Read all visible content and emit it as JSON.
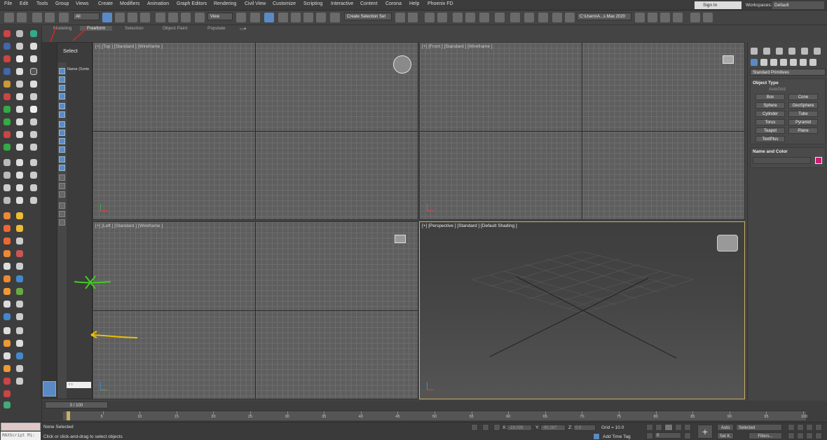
{
  "menu": {
    "items": [
      "File",
      "Edit",
      "Tools",
      "Group",
      "Views",
      "Create",
      "Modifiers",
      "Animation",
      "Graph Editors",
      "Rendering",
      "Civil View",
      "Customize",
      "Scripting",
      "Interactive",
      "Content",
      "Corona",
      "Help",
      "Phoenix FD"
    ]
  },
  "account": {
    "signin": "Sign In",
    "workspaces_label": "Workspaces:",
    "workspace": "Default"
  },
  "toolbar": {
    "filter": "All",
    "view": "View",
    "selection_set": "Create Selection Set",
    "path": "C:\\Users\\A...s Max 2020"
  },
  "ribbon": {
    "tabs": [
      "Modeling",
      "Freeform",
      "Selection",
      "Object Paint",
      "Populate"
    ],
    "active": "Freeform"
  },
  "scene_explorer": {
    "title": "Select",
    "column": "Name (Sorte"
  },
  "viewports": [
    {
      "label": "[+] [Top ] [Standard ] [Wireframe ]"
    },
    {
      "label": "[+] [Front ] [Standard ] [Wireframe ]"
    },
    {
      "label": "[+] [Left ] [Standard ] [Wireframe ]"
    },
    {
      "label": "[+] [Perspective ] [Standard ] [Default Shading ]"
    }
  ],
  "command_panel": {
    "category": "Standard Primitives",
    "object_type_title": "Object Type",
    "autogrid": "AutoGrid",
    "buttons": [
      "Box",
      "Cone",
      "Sphere",
      "GeoSphere",
      "Cylinder",
      "Tube",
      "Torus",
      "Pyramid",
      "Teapot",
      "Plane",
      "TextPlus"
    ],
    "name_color_title": "Name and Color",
    "object_color": "#c81e78"
  },
  "timeline": {
    "slider": "0 / 100",
    "ticks": [
      5,
      10,
      15,
      20,
      25,
      30,
      35,
      40,
      45,
      50,
      55,
      60,
      65,
      70,
      75,
      80,
      85,
      90,
      95,
      100
    ]
  },
  "status": {
    "maxscript": "MAXScript Mi:",
    "selection": "None Selected",
    "prompt": "Click or click-and-drag to select objects",
    "x": "-18.039",
    "y": "-90.287",
    "z": "0.0",
    "x_label": "X:",
    "y_label": "Y:",
    "z_label": "Z:",
    "grid": "Grid = 10.0",
    "add_time_tag": "Add Time Tag",
    "auto": "Auto",
    "selected": "Selected",
    "setk": "Set K.",
    "filters": "Filters...",
    "frame": "0"
  }
}
